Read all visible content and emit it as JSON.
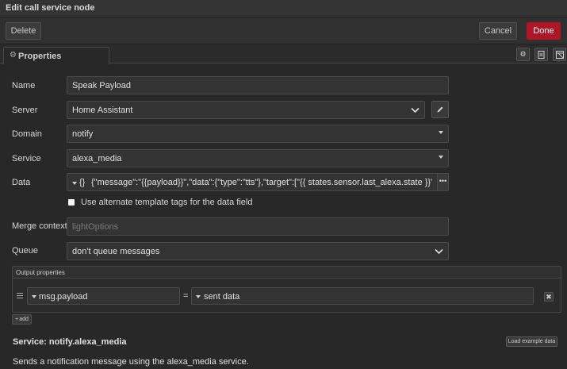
{
  "title": "Edit call service node",
  "toolbar": {
    "delete_label": "Delete",
    "cancel_label": "Cancel",
    "done_label": "Done"
  },
  "tabs": [
    {
      "label": "Properties",
      "icon": "gear-icon"
    }
  ],
  "tab_icons": [
    "gear-icon",
    "description-icon",
    "appearance-icon"
  ],
  "form": {
    "name_label": "Name",
    "name_value": "Speak Payload",
    "server_label": "Server",
    "server_value": "Home Assistant",
    "domain_label": "Domain",
    "domain_value": "notify",
    "service_label": "Service",
    "service_value": "alexa_media",
    "data_label": "Data",
    "data_type": "{}",
    "data_value": "{\"message\":\"{{payload}}\",\"data\":{\"type\":\"tts\"},\"target\":[\"{{ states.sensor.last_alexa.state }}\"]}",
    "alt_template_label": "Use alternate template tags for the data field",
    "alt_template_checked": false,
    "merge_label": "Merge context",
    "merge_placeholder": "lightOptions",
    "queue_label": "Queue",
    "queue_value": "don't queue messages"
  },
  "output": {
    "header": "Output properties",
    "rows": [
      {
        "prefix": "msg.",
        "property": "payload",
        "equals": "=",
        "value": "sent data"
      }
    ],
    "add_label": "add"
  },
  "info": {
    "title": "Service: notify.alexa_media",
    "example_button": "Load example data",
    "description": "Sends a notification message using the alexa_media service."
  },
  "colors": {
    "accent": "#ad1625",
    "background": "#282828",
    "field": "#333333"
  }
}
